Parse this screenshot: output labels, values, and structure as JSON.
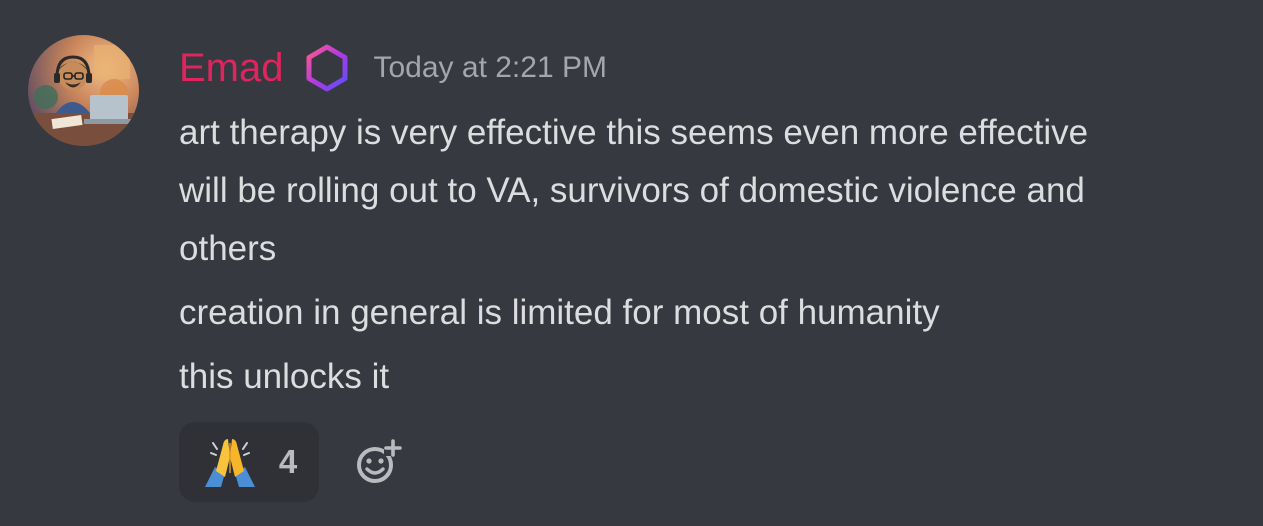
{
  "message": {
    "author": {
      "name": "Emad",
      "name_color": "#e0245e",
      "role_icon": "hexagon-icon"
    },
    "timestamp": "Today at 2:21 PM",
    "lines": [
      "art therapy is very effective this seems even more effective",
      "will be rolling out to VA, survivors of domestic violence and",
      "others",
      "creation in general is limited for most of humanity",
      "this unlocks it"
    ],
    "reactions": [
      {
        "emoji": "folded-hands-icon",
        "count": "4"
      }
    ],
    "add_reaction_icon": "add-reaction-icon"
  },
  "colors": {
    "background": "#36393f",
    "reaction_bg": "#2f3136",
    "message_text": "#dcddde",
    "timestamp_text": "#a3a6aa"
  }
}
